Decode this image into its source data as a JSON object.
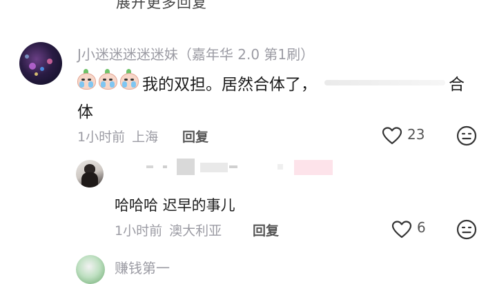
{
  "top_cut_text": "展开更多回复",
  "comments": [
    {
      "username": "J小迷迷迷迷迷妹（嘉年华 2.0 第1刷）",
      "emoji_icon": "crying-sprout-emoji-icon",
      "text_part1": "我的双担。居然合体了，",
      "text_part2": "合",
      "text_part3": "体",
      "time": "1小时前",
      "location": "上海",
      "reply_label": "回复",
      "like_count": "23"
    },
    {
      "text": "哈哈哈 迟早的事儿",
      "time": "1小时前",
      "location": "澳大利亚",
      "reply_label": "回复",
      "like_count": "6"
    },
    {
      "username": "赚钱第一"
    }
  ],
  "colors": {
    "meta_gray": "#9b9ba3",
    "text_dark": "#1b1b1b",
    "reply_gray": "#555555",
    "redacted_pink": "#fde3ea"
  }
}
